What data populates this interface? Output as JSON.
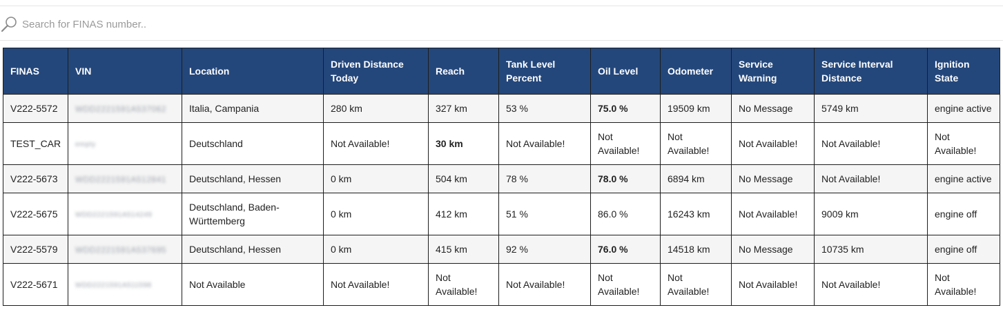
{
  "search": {
    "placeholder": "Search for FINAS number.."
  },
  "icons": {
    "search": "magnifier-icon"
  },
  "colors": {
    "header_bg": "#24477b",
    "warning_text": "#e00000",
    "row_stripe": "#f5f5f5"
  },
  "table": {
    "headers": {
      "finas": "FINAS",
      "vin": "VIN",
      "location": "Location",
      "driven_distance_today": "Driven Distance Today",
      "reach": "Reach",
      "tank_level_percent": "Tank Level Percent",
      "oil_level": "Oil Level",
      "odometer": "Odometer",
      "service_warning": "Service Warning",
      "service_interval_distance": "Service Interval Distance",
      "ignition_state": "Ignition State"
    },
    "rows": [
      {
        "finas": "V222-5572",
        "vin": "WDD2221591A537062",
        "location": "Italia, Campania",
        "driven_distance_today": "280 km",
        "reach": "327 km",
        "tank_level_percent": "53 %",
        "oil_level": "75.0 %",
        "odometer": "19509 km",
        "service_warning": "No Message",
        "service_interval_distance": "5749 km",
        "ignition_state": "engine active"
      },
      {
        "finas": "TEST_CAR",
        "vin": "empty",
        "location": "Deutschland",
        "driven_distance_today": "Not Available!",
        "reach": "30 km",
        "tank_level_percent": "Not Available!",
        "oil_level": "Not Available!",
        "odometer": "Not Available!",
        "service_warning": "Not Available!",
        "service_interval_distance": "Not Available!",
        "ignition_state": "Not Available!"
      },
      {
        "finas": "V222-5673",
        "vin": "WDD2221591A512841",
        "location": "Deutschland, Hessen",
        "driven_distance_today": "0 km",
        "reach": "504 km",
        "tank_level_percent": "78 %",
        "oil_level": "78.0 %",
        "odometer": "6894 km",
        "service_warning": "No Message",
        "service_interval_distance": "Not Available!",
        "ignition_state": "engine active"
      },
      {
        "finas": "V222-5675",
        "vin": "WDD2221591A514249",
        "location": "Deutschland, Baden-Württemberg",
        "driven_distance_today": "0 km",
        "reach": "412 km",
        "tank_level_percent": "51 %",
        "oil_level": "86.0 %",
        "odometer": "16243 km",
        "service_warning": "Not Available!",
        "service_interval_distance": "9009 km",
        "ignition_state": "engine off"
      },
      {
        "finas": "V222-5579",
        "vin": "WDD2221591A537695",
        "location": "Deutschland, Hessen",
        "driven_distance_today": "0 km",
        "reach": "415 km",
        "tank_level_percent": "92 %",
        "oil_level": "76.0 %",
        "odometer": "14518 km",
        "service_warning": "No Message",
        "service_interval_distance": "10735 km",
        "ignition_state": "engine off"
      },
      {
        "finas": "V222-5671",
        "vin": "WDD2221591A511598",
        "location": "Not Available",
        "driven_distance_today": "Not Available!",
        "reach": "Not Available!",
        "tank_level_percent": "Not Available!",
        "oil_level": "Not Available!",
        "odometer": "Not Available!",
        "service_warning": "Not Available!",
        "service_interval_distance": "Not Available!",
        "ignition_state": "Not Available!"
      }
    ]
  }
}
